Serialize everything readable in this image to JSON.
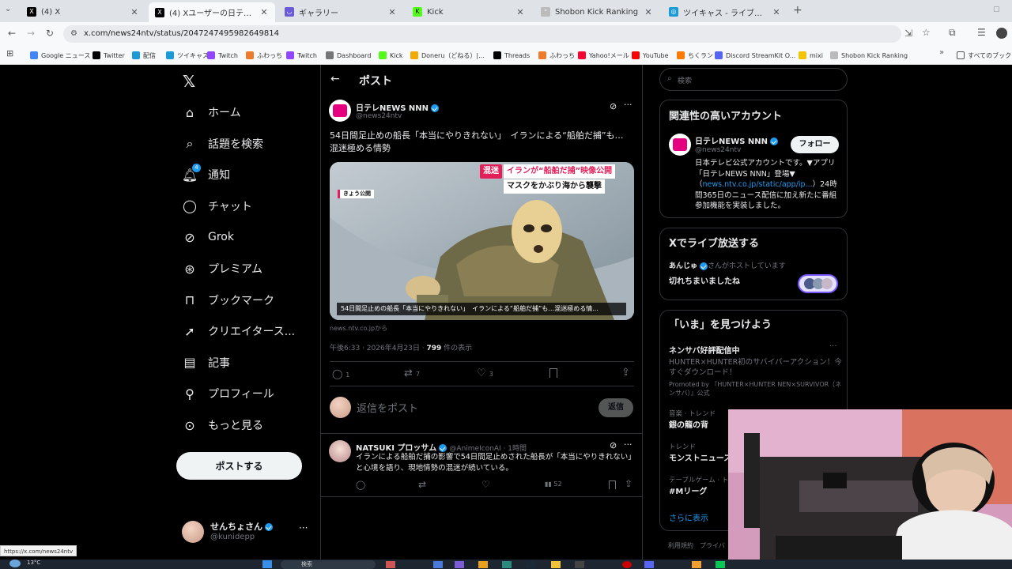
{
  "browser": {
    "tabs": [
      {
        "title": "(4) X",
        "icon": "x-logo-icon",
        "active": false
      },
      {
        "title": "(4) Xユーザーの日テレNEWS NNN",
        "icon": "x-logo-icon",
        "active": true
      },
      {
        "title": "ギャラリー",
        "icon": "gallery-icon",
        "active": false
      },
      {
        "title": "Kick",
        "icon": "kick-icon",
        "active": false
      },
      {
        "title": "Shobon Kick Ranking",
        "icon": "shobon-icon",
        "active": false
      },
      {
        "title": "ツイキャス - ライブでつながるコミュニ",
        "icon": "twitcasting-icon",
        "active": false
      }
    ],
    "url": "x.com/news24ntv/status/2047247495982649814",
    "bookmarks": [
      "Google ニュース",
      "Twitter",
      "配信",
      "ツイキャス",
      "Twitch",
      "ふわっち",
      "Twitch",
      "Dashboard",
      "Kick",
      "Doneru（どねる）|...",
      "Threads",
      "ふわっち",
      "Yahoo!メール",
      "YouTube",
      "ちくラン",
      "Discord StreamKit O...",
      "mixi",
      "Shobon Kick Ranking"
    ],
    "bookmarks_all": "すべてのブック",
    "status_url": "https://x.com/news24ntv"
  },
  "nav": {
    "items": [
      {
        "label": "ホーム",
        "icon": "home-icon"
      },
      {
        "label": "話題を検索",
        "icon": "search-icon"
      },
      {
        "label": "通知",
        "icon": "bell-icon",
        "badge": "4"
      },
      {
        "label": "チャット",
        "icon": "chat-icon"
      },
      {
        "label": "Grok",
        "icon": "grok-icon"
      },
      {
        "label": "プレミアム",
        "icon": "premium-icon"
      },
      {
        "label": "ブックマーク",
        "icon": "bookmark-icon"
      },
      {
        "label": "クリエイタース...",
        "icon": "rocket-icon"
      },
      {
        "label": "記事",
        "icon": "article-icon"
      },
      {
        "label": "プロフィール",
        "icon": "profile-icon"
      },
      {
        "label": "もっと見る",
        "icon": "more-circle-icon"
      }
    ],
    "post_button": "ポストする",
    "user": {
      "name": "せんちょさん",
      "handle": "@kunidepp"
    }
  },
  "main": {
    "header_title": "ポスト",
    "tweet": {
      "author": "日テレNEWS NNN",
      "handle": "@news24ntv",
      "text": "54日間足止めの船長「本当にやりきれない」　イランによる“船舶だ捕”も…混迷極める情勢",
      "media": {
        "tag_top": "混迷",
        "headline1": "イランが“船舶だ捕”映像公開",
        "headline2": "マスクをかぶり海から襲撃",
        "badge": "きょう公開",
        "caption": "54日間足止めの船長「本当にやりきれない」　イランによる“船舶だ捕”も…混迷極める情..."
      },
      "source": "news.ntv.co.jpから",
      "time": "午後6:33 · 2026年4月23日 · ",
      "views": "799",
      "views_suffix": " 件の表示",
      "counts": {
        "replies": "1",
        "reposts": "7",
        "likes": "3"
      }
    },
    "reply_placeholder": "返信をポスト",
    "reply_button": "返信",
    "reply": {
      "author": "NATSUKI プロッサム",
      "handle": "@AnimeIconAI · 1時間",
      "text": "イランによる船舶だ捕の影響で54日間足止めされた船長が「本当にやりきれない」と心境を語り、現地情勢の混迷が続いている。",
      "views": "52"
    }
  },
  "sidebar": {
    "search_placeholder": "検索",
    "related_title": "関連性の高いアカウント",
    "related": {
      "name": "日テレNEWS NNN",
      "handle": "@news24ntv",
      "follow": "フォロー",
      "bio_1": "日本テレビ公式アカウントです。▼アプリ「日テレNEWS NNN」登場▼（",
      "bio_link": "news.ntv.co.jp/static/app/ip...",
      "bio_2": "）24時間365日のニュース配信に加え新たに番組参加機能を実装しました。"
    },
    "live_title": "Xでライブ放送する",
    "live": {
      "host": "あんじゅ",
      "host_suffix": "さんがホストしています",
      "title": "切れちまいましたね"
    },
    "trends_title": "「いま」を見つけよう",
    "trends": [
      {
        "title": "ネンサバ好評配信中",
        "desc": "HUNTER×HUNTER初のサバイバーアクション！今すぐダウンロード！",
        "promo": "Promoted by 『HUNTER×HUNTER NEN×SURVIVOR（ネンサバ）』公式"
      },
      {
        "category": "音楽 · トレンド",
        "title": "銀の龍の背"
      },
      {
        "category": "トレンド",
        "title": "モンストニュース"
      },
      {
        "category": "テーブルゲーム · ト",
        "title": "#Mリーグ"
      }
    ],
    "show_more": "さらに表示",
    "footer": "利用規約　プライバ"
  },
  "taskbar": {
    "temp": "13°C",
    "search": "検索"
  },
  "colors": {
    "accent": "#1d9bf0",
    "bg": "#000000",
    "border": "#2f3336",
    "muted": "#71767b"
  }
}
